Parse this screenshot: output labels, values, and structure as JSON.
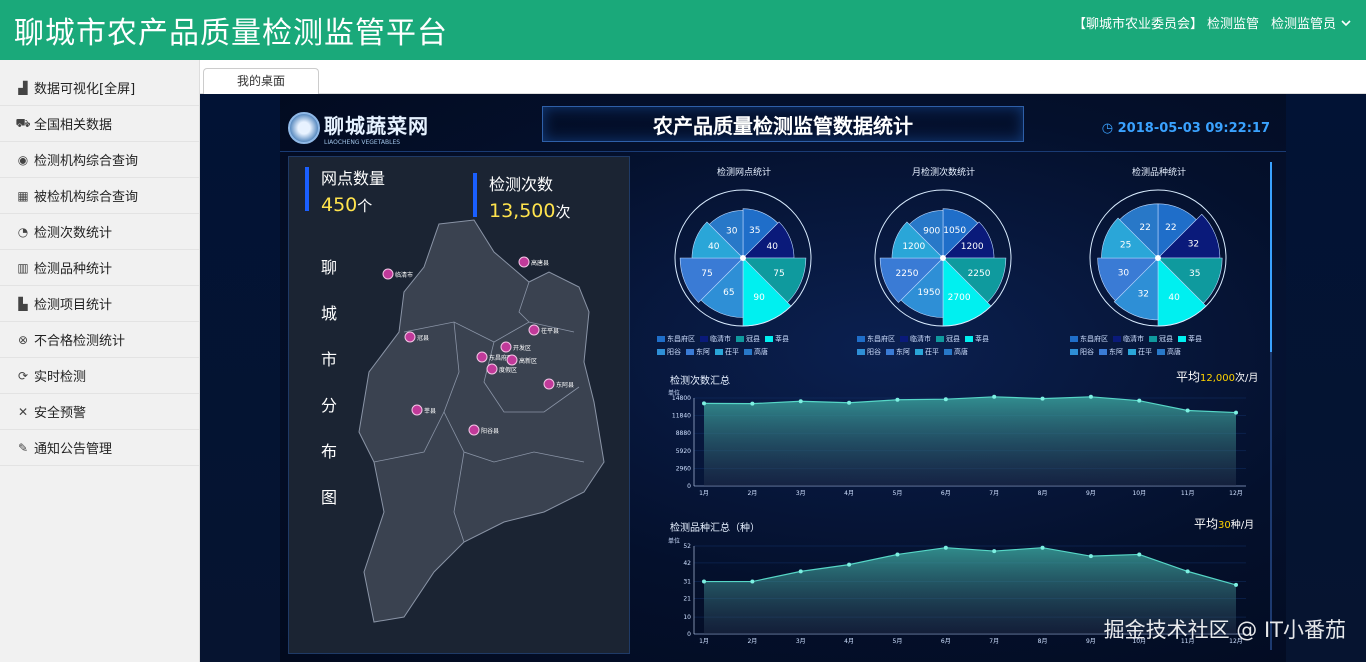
{
  "header": {
    "title": "聊城市农产品质量检测监管平台",
    "org": "【聊城市农业委员会】",
    "module": "检测监管",
    "user": "检测监管员"
  },
  "sidebar": {
    "items": [
      {
        "icon": "bar-chart-icon",
        "label": "数据可视化[全屏]"
      },
      {
        "icon": "car-icon",
        "label": "全国相关数据"
      },
      {
        "icon": "eye-icon",
        "label": "检测机构综合查询"
      },
      {
        "icon": "building-icon",
        "label": "被检机构综合查询"
      },
      {
        "icon": "pie-icon",
        "label": "检测次数统计"
      },
      {
        "icon": "bar-icon",
        "label": "检测品种统计"
      },
      {
        "icon": "column-chart-icon",
        "label": "检测项目统计"
      },
      {
        "icon": "circle-x-icon",
        "label": "不合格检测统计"
      },
      {
        "icon": "refresh-icon",
        "label": "实时检测"
      },
      {
        "icon": "wrench-icon",
        "label": "安全预警"
      },
      {
        "icon": "notice-icon",
        "label": "通知公告管理"
      }
    ]
  },
  "tabs": [
    {
      "label": "我的桌面"
    }
  ],
  "dashboard": {
    "logo_name": "聊城蔬菜网",
    "logo_sub": "LIAOCHENG VEGETABLES",
    "title": "农产品质量检测监管数据统计",
    "datetime": "2018-05-03 09:22:17",
    "stat1_label": "网点数量",
    "stat1_value": "450",
    "stat1_unit": "个",
    "stat2_label": "检测次数",
    "stat2_value": "13,500",
    "stat2_unit": "次",
    "map_title_chars": [
      "聊",
      "城",
      "市",
      "分",
      "布",
      "图"
    ],
    "map_cities": [
      "临清市",
      "高唐县",
      "茌平县",
      "冠县",
      "东昌府区",
      "开发区",
      "高新区",
      "度假区",
      "东阿县",
      "莘县",
      "阳谷县"
    ],
    "avg1_label": "平均",
    "avg1_value": "12,000",
    "avg1_unit": "次/月",
    "avg2_label": "平均",
    "avg2_value": "30",
    "avg2_unit": "种/月",
    "watermark": "掘金技术社区 @ IT小番茄"
  },
  "colors": {
    "header_bg": "#1aa97a",
    "slice": [
      "#1f6ec9",
      "#0a1a7a",
      "#0f9a9e",
      "#00f0f0",
      "#2e8fd6",
      "#3a7bd5",
      "#2aa6d8",
      "#2878c8"
    ]
  },
  "chart_data": [
    {
      "type": "pie",
      "title": "检测网点统计",
      "categories": [
        "东昌府区",
        "临清市",
        "冠县",
        "莘县",
        "阳谷",
        "东阿",
        "茌平",
        "高唐"
      ],
      "values": [
        35,
        40,
        75,
        90,
        65,
        75,
        40,
        30
      ]
    },
    {
      "type": "pie",
      "title": "月检测次数统计",
      "categories": [
        "东昌府区",
        "临清市",
        "冠县",
        "莘县",
        "阳谷",
        "东阿",
        "茌平",
        "高唐"
      ],
      "values": [
        1050,
        1200,
        2250,
        2700,
        1950,
        2250,
        1200,
        900
      ]
    },
    {
      "type": "pie",
      "title": "检测品种统计",
      "categories": [
        "东昌府区",
        "临清市",
        "冠县",
        "莘县",
        "阳谷",
        "东阿",
        "茌平",
        "高唐"
      ],
      "values": [
        22,
        32,
        35,
        40,
        32,
        30,
        25,
        22
      ]
    },
    {
      "type": "area",
      "title": "检测次数汇总",
      "ylabel": "单位",
      "ylim": [
        0,
        14800
      ],
      "yticks": [
        0,
        2960,
        5920,
        8880,
        11840,
        14800
      ],
      "categories": [
        "1月",
        "2月",
        "3月",
        "4月",
        "5月",
        "6月",
        "7月",
        "8月",
        "9月",
        "10月",
        "11月",
        "12月"
      ],
      "values": [
        13900,
        13850,
        14250,
        14000,
        14500,
        14600,
        15000,
        14700,
        15000,
        14350,
        12700,
        12350
      ]
    },
    {
      "type": "area",
      "title": "检测品种汇总（种）",
      "ylabel": "单位",
      "ylim": [
        0,
        52
      ],
      "yticks": [
        0,
        10,
        21,
        31,
        42,
        52
      ],
      "categories": [
        "1月",
        "2月",
        "3月",
        "4月",
        "5月",
        "6月",
        "7月",
        "8月",
        "9月",
        "10月",
        "11月",
        "12月"
      ],
      "values": [
        31,
        31,
        37,
        41,
        47,
        51,
        49,
        51,
        46,
        47,
        37,
        29
      ]
    }
  ]
}
